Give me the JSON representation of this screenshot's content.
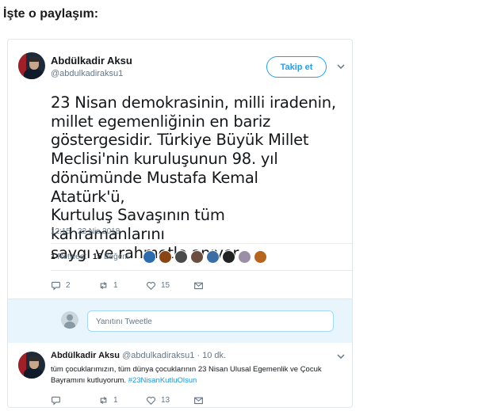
{
  "heading": "İşte o paylaşım:",
  "tweet": {
    "author_name": "Abdülkadir Aksu",
    "author_handle": "@abdulkadiraksu1",
    "follow_label": "Takip et",
    "text_lines": [
      "23 Nisan demokrasinin, milli iradenin,",
      "millet egemenliğinin en bariz",
      "göstergesidir. Türkiye Büyük Millet",
      "Meclisi'nin kuruluşunun 98. yıl",
      "dönümünde Mustafa Kemal Atatürk'ü,",
      "Kurtuluş Savaşının tüm kahramanlarını",
      "saygı ve rahmetle anıyor,"
    ],
    "timestamp": "12:15 - 22 Nis 2018",
    "retweet_count": "1",
    "retweet_label": "Retweet",
    "like_count": "15",
    "like_label": "Beğeni",
    "likers": [
      "#2b6cb0",
      "#8b4513",
      "#4a4a4a",
      "#6b4e3d",
      "#3a6ea5",
      "#222222",
      "#9b8fa6",
      "#b5651d"
    ],
    "actions": {
      "reply_count": "2",
      "retweet_count": "1",
      "like_count": "15"
    },
    "reply_placeholder": "Yanıtını Tweetle"
  },
  "reply": {
    "author_name": "Abdülkadir Aksu",
    "author_handle": "@abdulkadiraksu1",
    "time_ago": "· 10 dk.",
    "text": "tüm çocuklarımızın, tüm dünya çocuklarının 23 Nisan Ulusal Egemenlik ve Çocuk Bayramını kutluyorum.",
    "hashtag": "#23NisanKutluOlsun",
    "actions": {
      "retweet_count": "1",
      "like_count": "13"
    }
  },
  "colors": {
    "accent": "#1da1f2",
    "secondary_text": "#657786",
    "reply_box_bg": "#e8f5fd"
  },
  "icons": [
    "chevron-down-icon",
    "reply-icon",
    "retweet-icon",
    "like-icon",
    "message-icon",
    "user-placeholder-icon"
  ]
}
